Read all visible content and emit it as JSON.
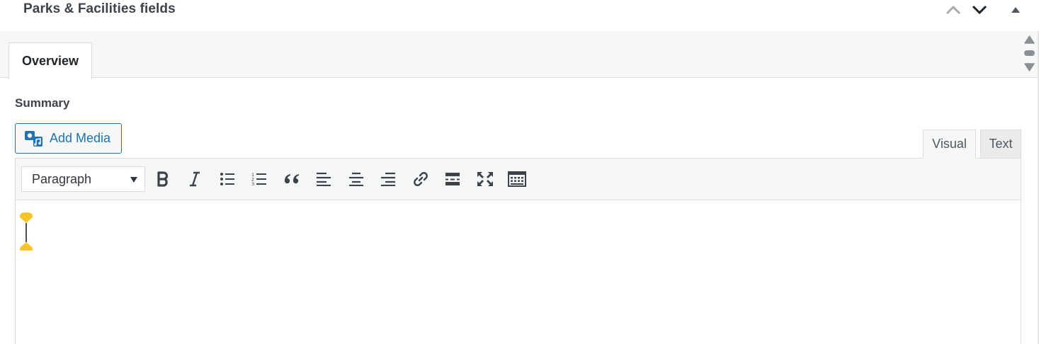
{
  "metabox": {
    "title": "Parks & Facilities fields",
    "move_up_icon": "chevron-up-icon",
    "move_down_icon": "chevron-down-icon",
    "toggle_icon": "triangle-up-icon"
  },
  "tabs": [
    {
      "label": "Overview",
      "active": true
    }
  ],
  "field": {
    "label": "Summary"
  },
  "editor": {
    "add_media_label": "Add Media",
    "add_media_icon": "media-icon",
    "mode_tabs": [
      {
        "label": "Visual",
        "active": true
      },
      {
        "label": "Text",
        "active": false
      }
    ],
    "format_select": {
      "value": "Paragraph",
      "options": [
        "Paragraph"
      ]
    },
    "toolbar_icons": [
      "bold-icon",
      "italic-icon",
      "bulleted-list-icon",
      "numbered-list-icon",
      "blockquote-icon",
      "align-left-icon",
      "align-center-icon",
      "align-right-icon",
      "link-icon",
      "read-more-icon",
      "fullscreen-icon",
      "toolbar-toggle-icon"
    ],
    "content": ""
  },
  "colors": {
    "accent": "#2271b1",
    "caret_handle": "#f7c52b",
    "toolbar_bg": "#f6f7f7",
    "border": "#dcdcde"
  }
}
